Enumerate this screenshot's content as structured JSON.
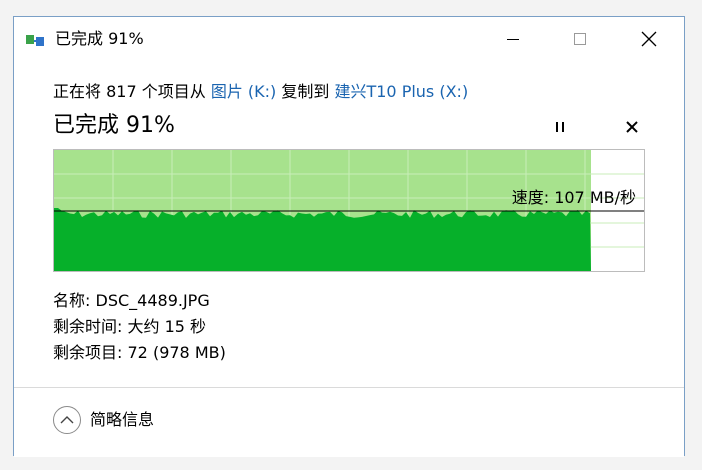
{
  "window": {
    "title": "已完成 91%",
    "icon": "file-copy-icon",
    "controls": [
      "minimize-icon",
      "maximize-icon",
      "close-icon"
    ]
  },
  "copy": {
    "desc_prefix": "正在将 817 个项目从 ",
    "source_link": "图片 (K:)",
    "desc_middle": " 复制到 ",
    "dest_link": "建兴T10 Plus (X:)",
    "heading": "已完成 91%",
    "progress_percent": 91
  },
  "graph": {
    "speed_text": "速度: 107 MB/秒",
    "colors": {
      "completed": "#a7e28d",
      "throughput": "#06b02a",
      "remaining": "#ffffff",
      "grid": "#c9eeb9"
    },
    "grid": true
  },
  "details": {
    "name_label": "名称:",
    "name_value": "DSC_4489.JPG",
    "time_label": "剩余时间:",
    "time_value": "大约 15 秒",
    "items_label": "剩余项目:",
    "items_value": "72 (978 MB)"
  },
  "footer": {
    "toggle_icon": "chevron-up-icon",
    "label": "简略信息"
  }
}
